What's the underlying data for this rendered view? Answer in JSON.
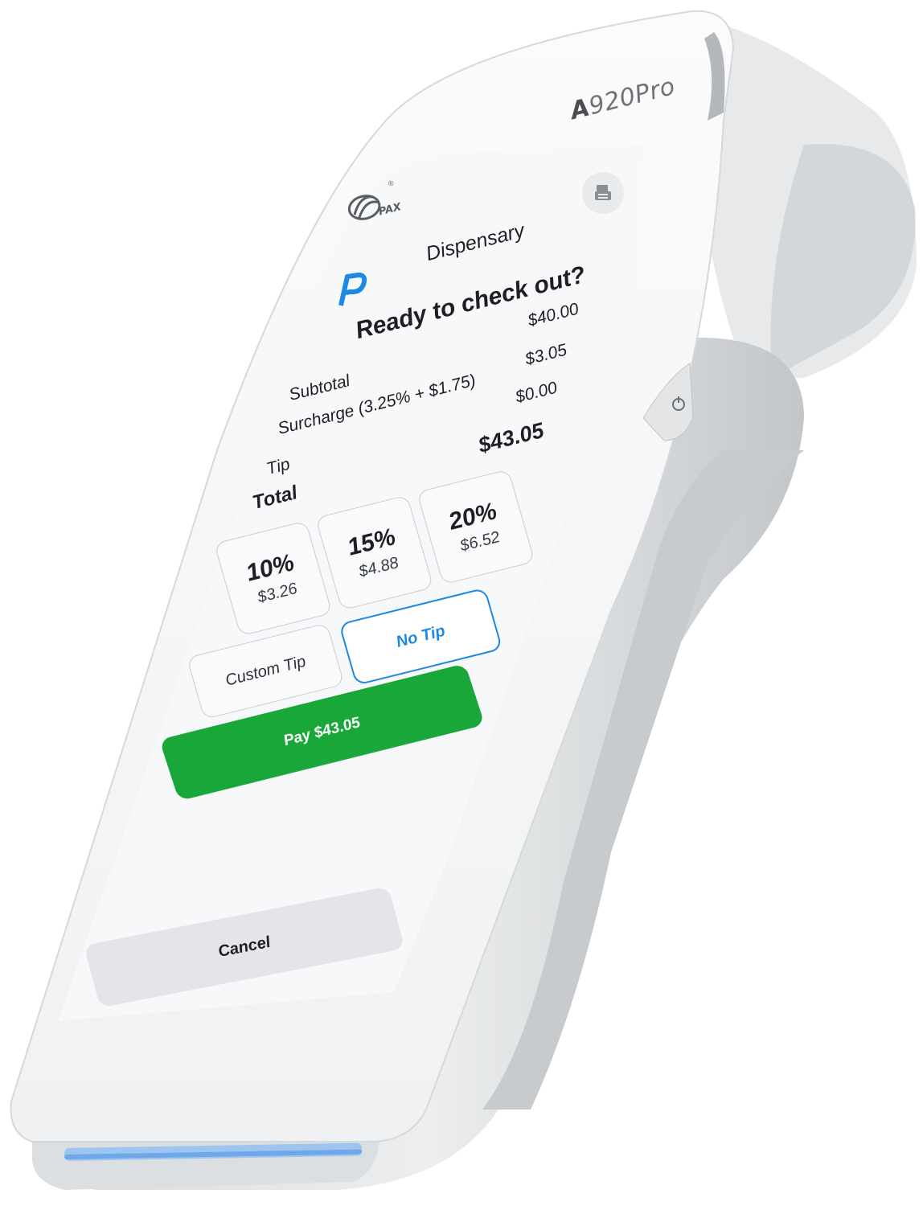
{
  "device": {
    "model_prefix": "A",
    "model_suffix": "920Pro",
    "brand": "PAX",
    "brand_mark": "®"
  },
  "screen": {
    "merchant_name": "Dispensary",
    "headline": "Ready to check out?",
    "summary": {
      "subtotal_label": "Subtotal",
      "subtotal_value": "$40.00",
      "surcharge_label": "Surcharge (3.25% + $1.75)",
      "surcharge_value": "$3.05",
      "tip_label": "Tip",
      "tip_value": "$0.00",
      "total_label": "Total",
      "total_value": "$43.05"
    },
    "tip_options": [
      {
        "percent": "10%",
        "amount": "$3.26"
      },
      {
        "percent": "15%",
        "amount": "$4.88"
      },
      {
        "percent": "20%",
        "amount": "$6.52"
      }
    ],
    "custom_tip_label": "Custom Tip",
    "no_tip_label": "No Tip",
    "selected_tip": "No Tip",
    "pay_label": "Pay $43.05",
    "cancel_label": "Cancel"
  },
  "colors": {
    "accent_blue": "#1e88e5",
    "pay_green": "#1aa73a",
    "cancel_gray": "#e4e5e8"
  },
  "icons": [
    "pax-logo-icon",
    "receipt-printer-icon",
    "payment-p-logo-icon",
    "power-icon"
  ]
}
